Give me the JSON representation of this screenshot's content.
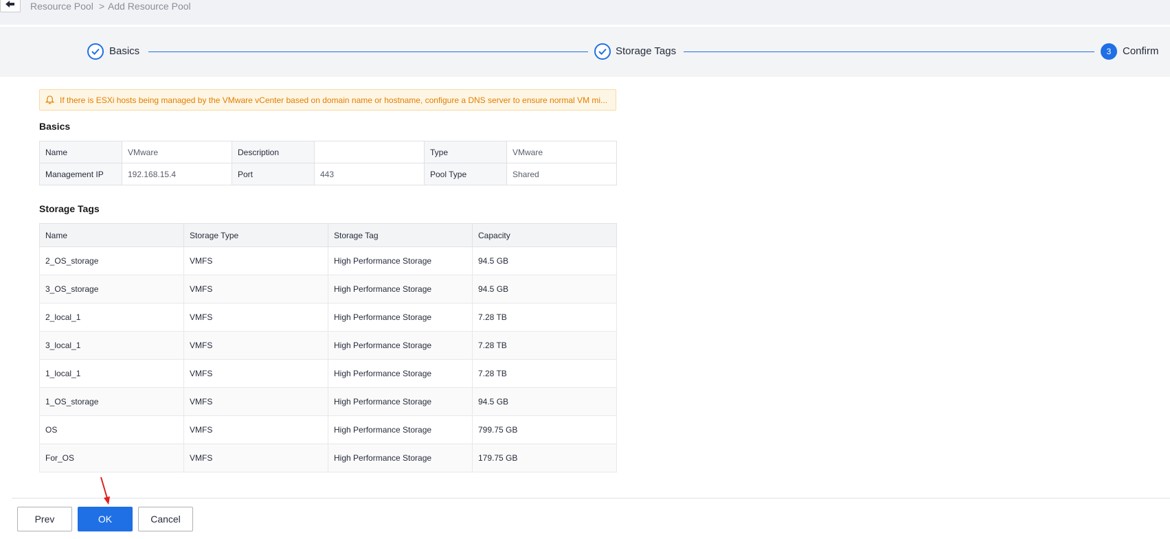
{
  "breadcrumb": {
    "items": [
      "Resource Pool",
      "Add Resource Pool"
    ],
    "separator": ">"
  },
  "stepper": {
    "steps": [
      {
        "label": "Basics",
        "status": "done"
      },
      {
        "label": "Storage Tags",
        "status": "done"
      },
      {
        "label": "Confirm",
        "status": "active",
        "number": "3"
      }
    ]
  },
  "warning": {
    "text": "If there is ESXi hosts being managed by the VMware vCenter based on domain name or hostname, configure a DNS server to ensure normal VM mi..."
  },
  "basics": {
    "title": "Basics",
    "rows": [
      [
        {
          "key": "Name",
          "value": "VMware"
        },
        {
          "key": "Description",
          "value": ""
        },
        {
          "key": "Type",
          "value": "VMware"
        }
      ],
      [
        {
          "key": "Management IP",
          "value": "192.168.15.4"
        },
        {
          "key": "Port",
          "value": "443"
        },
        {
          "key": "Pool Type",
          "value": "Shared"
        }
      ]
    ]
  },
  "storage_tags": {
    "title": "Storage Tags",
    "columns": [
      "Name",
      "Storage Type",
      "Storage Tag",
      "Capacity"
    ],
    "rows": [
      [
        "2_OS_storage",
        "VMFS",
        "High Performance Storage",
        "94.5 GB"
      ],
      [
        "3_OS_storage",
        "VMFS",
        "High Performance Storage",
        "94.5 GB"
      ],
      [
        "2_local_1",
        "VMFS",
        "High Performance Storage",
        "7.28 TB"
      ],
      [
        "3_local_1",
        "VMFS",
        "High Performance Storage",
        "7.28 TB"
      ],
      [
        "1_local_1",
        "VMFS",
        "High Performance Storage",
        "7.28 TB"
      ],
      [
        "1_OS_storage",
        "VMFS",
        "High Performance Storage",
        "94.5 GB"
      ],
      [
        "OS",
        "VMFS",
        "High Performance Storage",
        "799.75 GB"
      ],
      [
        "For_OS",
        "VMFS",
        "High Performance Storage",
        "179.75 GB"
      ]
    ]
  },
  "footer": {
    "prev_label": "Prev",
    "ok_label": "OK",
    "cancel_label": "Cancel"
  },
  "colors": {
    "primary": "#1f6fe5",
    "warning_text": "#e37d00",
    "warning_bg": "#fef6e4",
    "annotation_arrow": "#e02020"
  },
  "icons": {
    "back": "arrow-left-icon",
    "step_done": "check-circle-icon",
    "warning": "bell-icon"
  }
}
